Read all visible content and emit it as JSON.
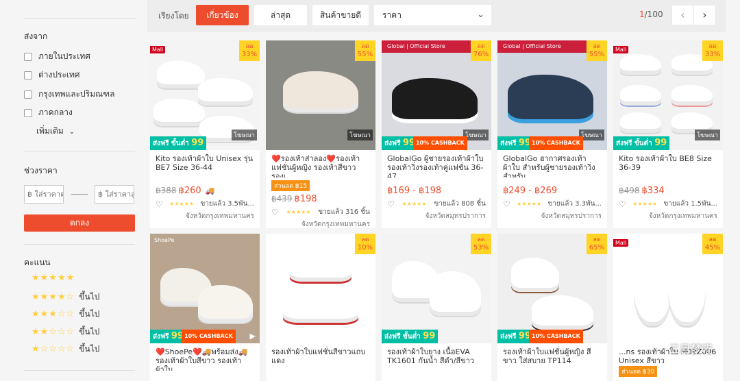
{
  "sidebar": {
    "ship_from_title": "ส่งจาก",
    "ship_from_options": [
      "ภายในประเทศ",
      "ต่างประเทศ",
      "กรุงเทพและปริมณฑล",
      "ภาคกลาง"
    ],
    "more_label": "เพิ่มเติม",
    "price_range_title": "ช่วงราคา",
    "price_min_placeholder": "฿ ใส่ราคาต่ำ",
    "price_max_placeholder": "฿ ใส่ราคาสู",
    "apply_label": "ตกลง",
    "rating_title": "คะแนน",
    "ratings": [
      {
        "stars": "★★★★★",
        "suffix": ""
      },
      {
        "stars": "★★★★☆",
        "suffix": "ขึ้นไป"
      },
      {
        "stars": "★★★☆☆",
        "suffix": "ขึ้นไป"
      },
      {
        "stars": "★★☆☆☆",
        "suffix": "ขึ้นไป"
      },
      {
        "stars": "★☆☆☆☆",
        "suffix": "ขึ้นไป"
      }
    ]
  },
  "sortbar": {
    "label": "เรียงโดย",
    "buttons": [
      "เกี่ยวข้อง",
      "ล่าสุด",
      "สินค้าขายดี"
    ],
    "price_select": "ราคา",
    "page_current": "1",
    "page_total": "/100",
    "prev": "‹",
    "next": "›"
  },
  "products": [
    {
      "title": "Kito รองเท้าผ้าใบ Unisex รุ่น BE7 Size 36-44",
      "mall": "Mall",
      "disc_label": "ลด",
      "disc": "33%",
      "orig": "฿388",
      "price": "฿260",
      "rating": "★★★★★",
      "sold": "ขายแล้ว 3.5พัน...",
      "loc": "จังหวัดกรุงเทพมหานคร",
      "ad": "โฆษณา",
      "freeship": "ส่งฟรี ขั้นต่ำ",
      "freeship_amt": "99",
      "tag": ""
    },
    {
      "title": "❤️รองเท้าส่าลอง❤️รองเท้าแฟชั่นผู้หญิง รองเท้าสีขาว รองเ...",
      "mall": "",
      "disc_label": "ลด",
      "disc": "55%",
      "orig": "฿439",
      "price": "฿198",
      "rating": "★★★★★",
      "sold": "ขายแล้ว 316 ชิ้น",
      "loc": "จังหวัดกรุงเทพมหานคร",
      "ad": "โฆษณา",
      "freeship": "",
      "freeship_amt": "",
      "tag": "ส่วนลด ฿15"
    },
    {
      "title": "GlobalGo ผู้ชายรองเท้าผ้าใบ รองเท้าวิ่งรองเท้าคู่แฟชั่น 36-47",
      "mall": "",
      "disc_label": "ลด",
      "disc": "76%",
      "orig": "",
      "price": "฿169 - ฿198",
      "rating": "★★★★★",
      "sold": "ขายแล้ว 808 ชิ้น",
      "loc": "จังหวัดสมุทรปราการ",
      "ad": "โฆษณา",
      "freeship": "ส่งฟรี",
      "freeship_amt": "99",
      "tag": "",
      "store": "Global | Official Store",
      "cashback": "10% CASHBACK"
    },
    {
      "title": "GlobalGo ฮากาศรองเท้าผ้าใบ สำหรับผู้ชายรองเท้าวิ่งสำหรับ...",
      "mall": "",
      "disc_label": "ลด",
      "disc": "55%",
      "orig": "",
      "price": "฿249 - ฿269",
      "rating": "★★★★★",
      "sold": "ขายแล้ว 3.3พัน...",
      "loc": "จังหวัดสมุทรปราการ",
      "ad": "โฆษณา",
      "freeship": "ส่งฟรี",
      "freeship_amt": "99",
      "tag": "",
      "store": "Global | Official Store",
      "cashback": "10% CASHBACK"
    },
    {
      "title": "Kito รองเท้าผ้าใบ BE8 Size 36-39",
      "mall": "Mall",
      "disc_label": "ลด",
      "disc": "33%",
      "orig": "฿498",
      "price": "฿334",
      "rating": "★★★★★",
      "sold": "ขายแล้ว 1.5พัน...",
      "loc": "จังหวัดกรุงเทพมหานคร",
      "ad": "โฆษณา",
      "freeship": "ส่งฟรี ขั้นต่ำ",
      "freeship_amt": "99",
      "tag": ""
    },
    {
      "title": "❤️ShoePe❤️🚚พร้อมส่ง🚚 รองเท้าผ้าใบสีขาว รองเท้าผ้าใบ...",
      "mall": "",
      "disc_label": "",
      "disc": "",
      "orig": "",
      "price": "",
      "rating": "",
      "sold": "",
      "loc": "",
      "ad": "",
      "freeship": "ส่งฟรี",
      "freeship_amt": "99",
      "tag": "",
      "brand": "ShoePe",
      "cashback": "10% CASHBACK"
    },
    {
      "title": "รองเท้าผ้าใบแฟชั่นสีขาวแถบแดง",
      "mall": "",
      "disc_label": "ลด",
      "disc": "10%",
      "orig": "",
      "price": "",
      "rating": "",
      "sold": "",
      "loc": "",
      "ad": "",
      "freeship": "",
      "freeship_amt": "",
      "tag": ""
    },
    {
      "title": "รองเท้าผ้าใบยาง เนื้อEVA TK1601 กันน้ำ สีดำ/สีขาว",
      "mall": "",
      "disc_label": "ลด",
      "disc": "53%",
      "orig": "",
      "price": "",
      "rating": "",
      "sold": "",
      "loc": "",
      "ad": "",
      "freeship": "ส่งฟรี ขั้นต่ำ",
      "freeship_amt": "99",
      "tag": ""
    },
    {
      "title": "รองเท้าผ้าใบแฟชั่นผู้หญิง สีขาว ใส่สบาย TP114",
      "mall": "",
      "disc_label": "ลด",
      "disc": "65%",
      "orig": "",
      "price": "",
      "rating": "",
      "sold": "",
      "loc": "",
      "ad": "",
      "freeship": "ส่งฟรี",
      "freeship_amt": "99",
      "tag": "",
      "cashback": "10% CASHBACK"
    },
    {
      "title": "...ns รองเท้าผ้าใบ M09Z006 Unisex สีขาว",
      "mall": "Mall",
      "disc_label": "ลด",
      "disc": "45%",
      "orig": "",
      "price": "",
      "rating": "",
      "sold": "",
      "loc": "",
      "ad": "",
      "freeship": "",
      "freeship_amt": "",
      "tag": "ส่วนลด ฿30"
    }
  ],
  "watermark": "三目梦呓",
  "colors": {
    "accent": "#ee4d2d",
    "discount_badge": "#ffd424",
    "freeship": "#00bfa5",
    "mall": "#d0011b"
  }
}
